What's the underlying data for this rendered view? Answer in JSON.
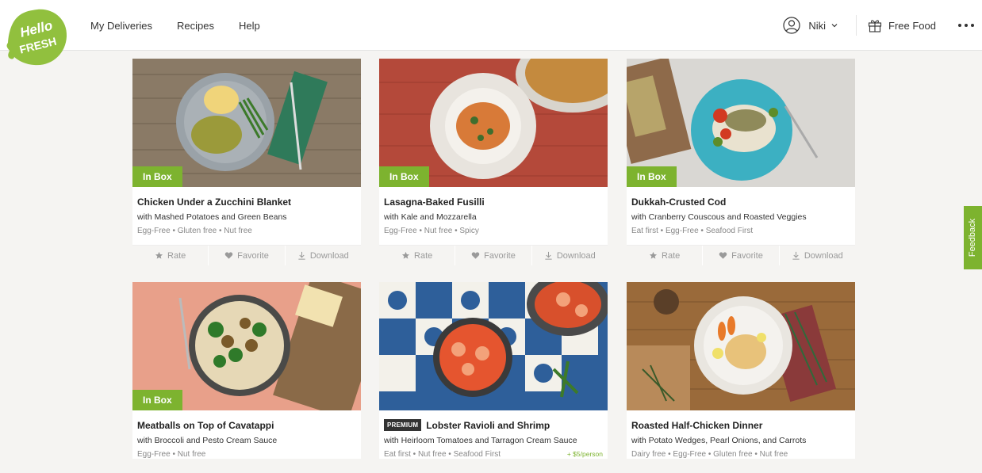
{
  "brand": {
    "logo_line1": "Hello",
    "logo_line2": "FRESH",
    "color": "#7db32f"
  },
  "nav": [
    "My Deliveries",
    "Recipes",
    "Help"
  ],
  "user": {
    "name": "Niki",
    "icon": "user-icon"
  },
  "free_food": "Free Food",
  "feedback": "Feedback",
  "actions": {
    "rate": "Rate",
    "favorite": "Favorite",
    "download": "Download"
  },
  "inbox_label": "In Box",
  "premium_label": "PREMIUM",
  "recipes": [
    {
      "title": "Chicken Under a Zucchini Blanket",
      "subtitle": "with Mashed Potatoes and Green Beans",
      "tags": "Egg-Free • Gluten free • Nut free",
      "in_box": true
    },
    {
      "title": "Lasagna-Baked Fusilli",
      "subtitle": "with Kale and Mozzarella",
      "tags": "Egg-Free • Nut free • Spicy",
      "in_box": true
    },
    {
      "title": "Dukkah-Crusted Cod",
      "subtitle": "with Cranberry Couscous and Roasted Veggies",
      "tags": "Eat first • Egg-Free • Seafood First",
      "in_box": true
    },
    {
      "title": "Meatballs on Top of Cavatappi",
      "subtitle": "with Broccoli and Pesto Cream Sauce",
      "tags": "Egg-Free • Nut free",
      "in_box": true
    },
    {
      "title": "Lobster Ravioli and Shrimp",
      "subtitle": "with Heirloom Tomatoes and Tarragon Cream Sauce",
      "tags": "Eat first • Nut free • Seafood First",
      "in_box": false,
      "premium": true,
      "extra": "+ $5/person"
    },
    {
      "title": "Roasted Half-Chicken Dinner",
      "subtitle": "with Potato Wedges, Pearl Onions, and Carrots",
      "tags": "Dairy free • Egg-Free • Gluten free • Nut free",
      "in_box": false
    }
  ]
}
